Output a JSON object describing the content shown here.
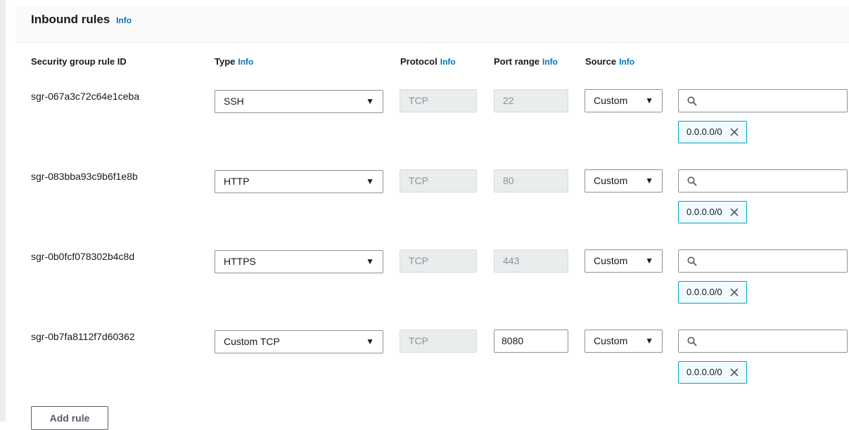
{
  "section": {
    "title": "Inbound rules",
    "info": "Info"
  },
  "columns": {
    "rule_id": "Security group rule ID",
    "type": "Type",
    "protocol": "Protocol",
    "port_range": "Port range",
    "source": "Source",
    "info": "Info"
  },
  "rules": [
    {
      "id": "sgr-067a3c72c64e1ceba",
      "type": "SSH",
      "protocol": "TCP",
      "port": "22",
      "source_type": "Custom",
      "cidr": "0.0.0.0/0"
    },
    {
      "id": "sgr-083bba93c9b6f1e8b",
      "type": "HTTP",
      "protocol": "TCP",
      "port": "80",
      "source_type": "Custom",
      "cidr": "0.0.0.0/0"
    },
    {
      "id": "sgr-0b0fcf078302b4c8d",
      "type": "HTTPS",
      "protocol": "TCP",
      "port": "443",
      "source_type": "Custom",
      "cidr": "0.0.0.0/0"
    },
    {
      "id": "sgr-0b7fa8112f7d60362",
      "type": "Custom TCP",
      "protocol": "TCP",
      "port": "8080",
      "source_type": "Custom",
      "cidr": "0.0.0.0/0"
    }
  ],
  "add_rule": "Add rule",
  "colors": {
    "link": "#0073bb",
    "token_border": "#00a1c9",
    "disabled_bg": "#eaeded"
  }
}
